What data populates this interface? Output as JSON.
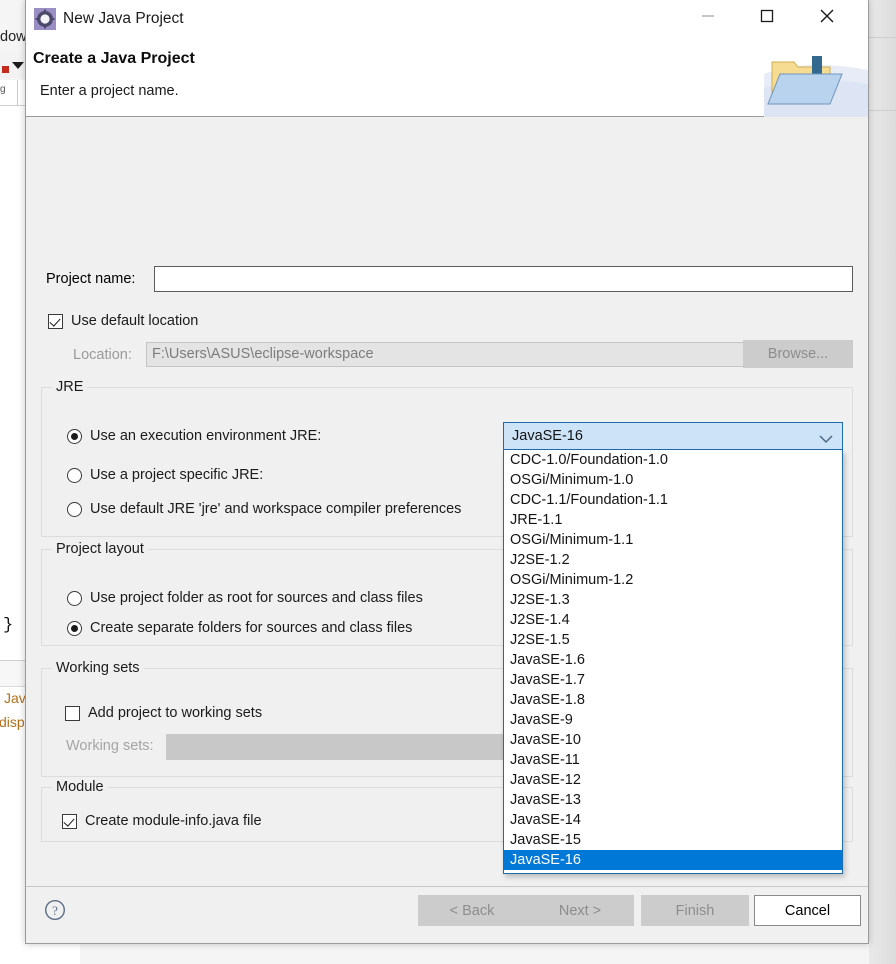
{
  "background": {
    "menu_fragment": "dow",
    "tab_label": "g",
    "editor_brace": "}",
    "lower_text_1": "Jav",
    "lower_text_2": "disp"
  },
  "dialog": {
    "title": "New Java Project",
    "app_icon": "gear-icon",
    "window_controls": {
      "minimize": "minimize-icon",
      "maximize": "maximize-icon",
      "close": "close-icon"
    },
    "header": {
      "title": "Create a Java Project",
      "description": "Enter a project name.",
      "banner_icon": "java-project-folder-icon"
    },
    "project_name": {
      "label": "Project name:",
      "value": "",
      "placeholder": ""
    },
    "use_default_location": {
      "label": "Use default location",
      "checked": true
    },
    "location": {
      "label": "Location:",
      "value": "F:\\Users\\ASUS\\eclipse-workspace",
      "browse_label": "Browse...",
      "browse_enabled": false
    },
    "jre": {
      "group_title": "JRE",
      "options": [
        {
          "label": "Use an execution environment JRE:",
          "selected": true
        },
        {
          "label": "Use a project specific JRE:",
          "selected": false
        },
        {
          "label": "Use default JRE 'jre' and workspace compiler preferences",
          "selected": false
        }
      ],
      "combo": {
        "selected_value": "JavaSE-16",
        "expanded": true,
        "chevron": "chevron-down-icon",
        "options": [
          "CDC-1.0/Foundation-1.0",
          "OSGi/Minimum-1.0",
          "CDC-1.1/Foundation-1.1",
          "JRE-1.1",
          "OSGi/Minimum-1.1",
          "J2SE-1.2",
          "OSGi/Minimum-1.2",
          "J2SE-1.3",
          "J2SE-1.4",
          "J2SE-1.5",
          "JavaSE-1.6",
          "JavaSE-1.7",
          "JavaSE-1.8",
          "JavaSE-9",
          "JavaSE-10",
          "JavaSE-11",
          "JavaSE-12",
          "JavaSE-13",
          "JavaSE-14",
          "JavaSE-15",
          "JavaSE-16"
        ],
        "highlight_color": "#0078d7"
      }
    },
    "project_layout": {
      "group_title": "Project layout",
      "options": [
        {
          "label": "Use project folder as root for sources and class files",
          "selected": false
        },
        {
          "label": "Create separate folders for sources and class files",
          "selected": true
        }
      ]
    },
    "working_sets": {
      "group_title": "Working sets",
      "add_label": "Add project to working sets",
      "add_checked": false,
      "field_label": "Working sets:",
      "field_value": ""
    },
    "module": {
      "group_title": "Module",
      "create_label": "Create module-info.java file",
      "create_checked": true
    },
    "footer": {
      "help_icon": "help-icon",
      "buttons": [
        {
          "label": "< Back",
          "enabled": false
        },
        {
          "label": "Next >",
          "enabled": false
        },
        {
          "label": "Finish",
          "enabled": false
        },
        {
          "label": "Cancel",
          "enabled": true
        }
      ]
    }
  }
}
